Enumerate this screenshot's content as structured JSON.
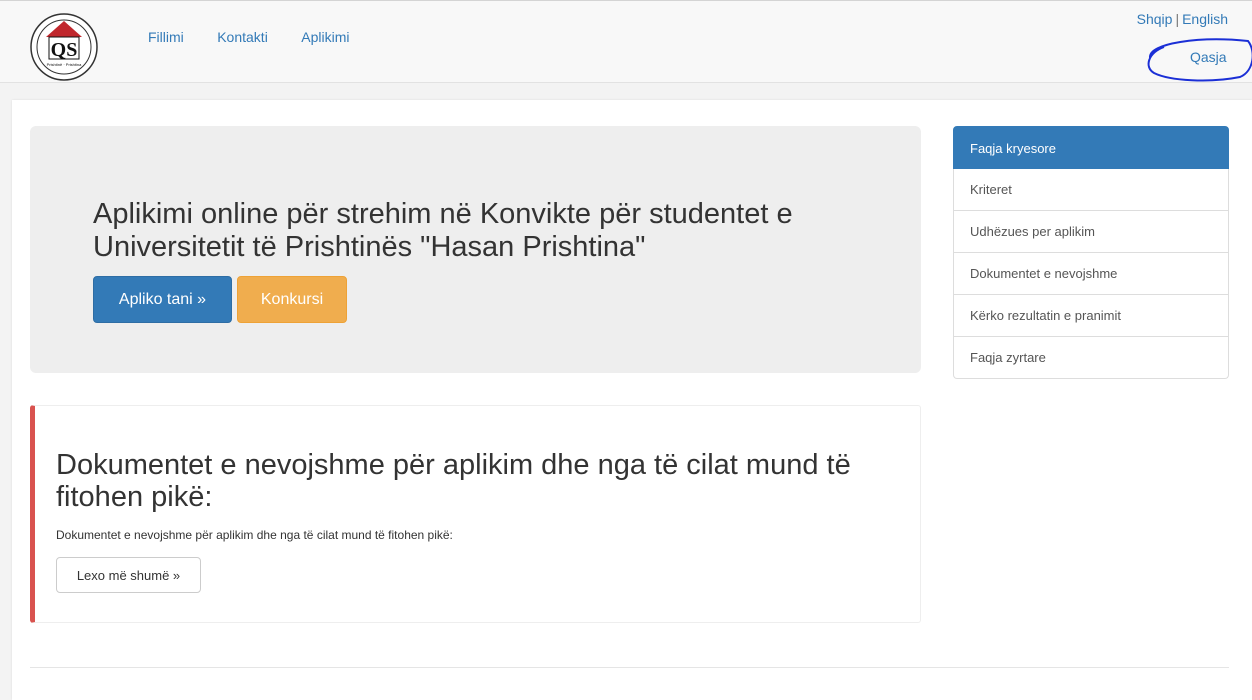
{
  "navbar": {
    "links": [
      "Fillimi",
      "Kontakti",
      "Aplikimi"
    ],
    "lang_sq": "Shqip",
    "lang_sep": "|",
    "lang_en": "English",
    "login": "Qasja"
  },
  "logo": {
    "letters": "QS",
    "caption": "Prishtinë · Prishtina"
  },
  "hero": {
    "title": "Aplikimi online për strehim në Konvikte për studentet e Universitetit të Prishtinës \"Hasan Prishtina\"",
    "apply_button": "Apliko tani »",
    "contest_button": "Konkursi"
  },
  "callout": {
    "heading": "Dokumentet e nevojshme për aplikim dhe nga të cilat mund të fitohen pikë:",
    "text": "Dokumentet e nevojshme për aplikim dhe nga të cilat mund të fitohen pikë:",
    "more_button": "Lexo më shumë »"
  },
  "sidebar": {
    "items": [
      "Faqja kryesore",
      "Kriteret",
      "Udhëzues per aplikim",
      "Dokumentet e nevojshme",
      "Kërko rezultatin e pranimit",
      "Faqja zyrtare"
    ]
  },
  "colors": {
    "primary": "#337ab7",
    "warning": "#f0ad4e",
    "danger_border": "#d9534f",
    "annotation_ink": "#1b2fd6"
  }
}
